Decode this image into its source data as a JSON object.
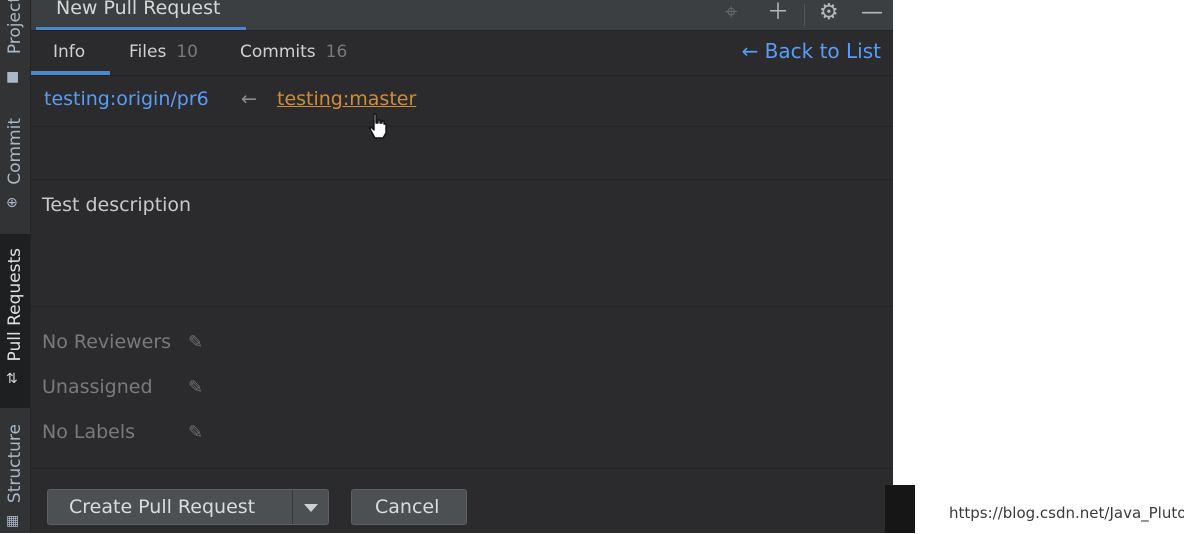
{
  "sidebar": {
    "items": [
      {
        "label": "Project",
        "icon": "folder-icon"
      },
      {
        "label": "Commit",
        "icon": "commit-icon"
      },
      {
        "label": "Pull Requests",
        "icon": "pull-request-icon"
      },
      {
        "label": "Structure",
        "icon": "structure-icon"
      }
    ]
  },
  "window": {
    "title": "New Pull Request",
    "toolbar_icons": [
      "crosshair-icon",
      "plus-icon",
      "gear-icon",
      "minimize-icon"
    ]
  },
  "tabs": [
    {
      "label": "Info",
      "count": ""
    },
    {
      "label": "Files",
      "count": "10"
    },
    {
      "label": "Commits",
      "count": "16"
    }
  ],
  "back_link": "← Back to List",
  "branches": {
    "source": "testing:origin/pr6",
    "arrow": "←",
    "target": "testing:master"
  },
  "title_field": {
    "value": ""
  },
  "description": "Test description",
  "meta": {
    "reviewers": "No Reviewers",
    "assignee": "Unassigned",
    "labels": "No Labels"
  },
  "footer": {
    "create_label": "Create Pull Request",
    "cancel_label": "Cancel"
  },
  "watermark": "https://blog.csdn.net/Java_Pluto",
  "colors": {
    "accent": "#589df6",
    "target_branch": "#d08c36",
    "panel_bg": "#2b2b2d"
  }
}
